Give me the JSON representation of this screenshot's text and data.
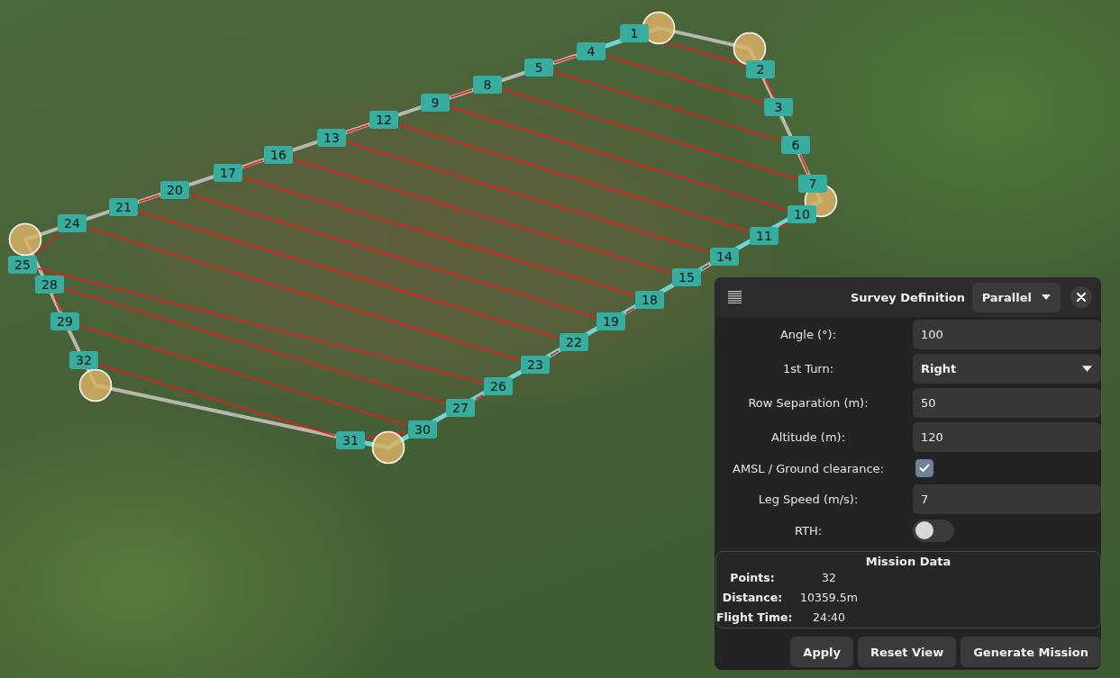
{
  "map": {
    "waypoints": [
      "1",
      "2",
      "3",
      "4",
      "5",
      "6",
      "7",
      "8",
      "9",
      "10",
      "11",
      "12",
      "13",
      "14",
      "15",
      "16",
      "17",
      "18",
      "19",
      "20",
      "21",
      "22",
      "23",
      "24",
      "25",
      "26",
      "27",
      "28",
      "29",
      "30",
      "31",
      "32"
    ]
  },
  "survey_panel": {
    "title": "Survey Definition",
    "pattern": {
      "value": "Parallel"
    },
    "fields": [
      {
        "kind": "input",
        "label": "Angle (°):",
        "value": "100"
      },
      {
        "kind": "dropdown",
        "label": "1st Turn:",
        "value": "Right"
      },
      {
        "kind": "input",
        "label": "Row Separation (m):",
        "value": "50"
      },
      {
        "kind": "input",
        "label": "Altitude (m):",
        "value": "120"
      },
      {
        "kind": "checkbox",
        "label": "AMSL / Ground clearance:",
        "checked": true
      },
      {
        "kind": "input",
        "label": "Leg Speed (m/s):",
        "value": "7"
      },
      {
        "kind": "toggle",
        "label": "RTH:",
        "on": false
      }
    ],
    "mission_data": {
      "title": "Mission Data",
      "rows": [
        {
          "label": "Points:",
          "value": "32"
        },
        {
          "label": "Distance:",
          "value": "10359.5m"
        },
        {
          "label": "Flight Time:",
          "value": "24:40"
        }
      ]
    },
    "buttons": [
      "Apply",
      "Reset View",
      "Generate Mission"
    ]
  }
}
